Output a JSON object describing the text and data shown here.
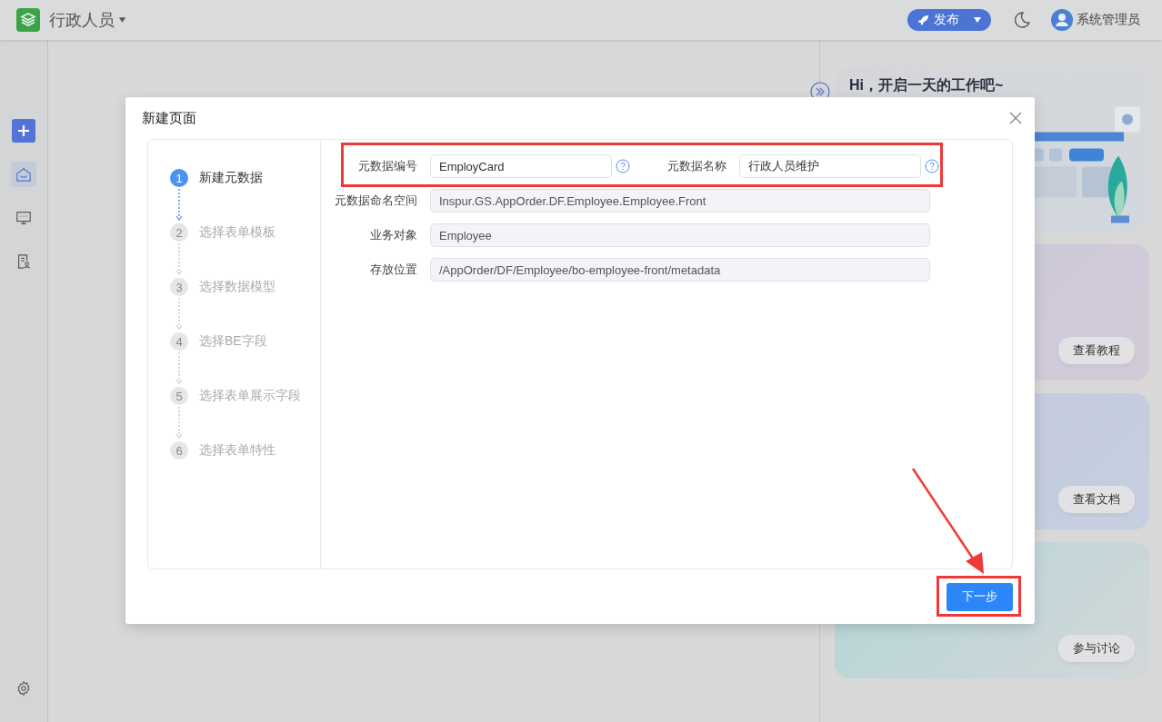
{
  "app": {
    "title": "行政人员",
    "publish_button": "发布",
    "user_name": "系统管理员"
  },
  "sidebar": {
    "items": [
      {
        "kind": "add",
        "selected": false
      },
      {
        "kind": "home",
        "selected": true
      },
      {
        "kind": "monitor",
        "selected": false
      },
      {
        "kind": "document",
        "selected": false
      }
    ]
  },
  "right_panel": {
    "greeting": "Hi，开启一天的工作吧~",
    "cards": [
      {
        "kind": "tutorial",
        "button": "查看教程"
      },
      {
        "kind": "docs",
        "button": "查看文档"
      },
      {
        "kind": "discuss",
        "button": "参与讨论"
      }
    ]
  },
  "dialog": {
    "title": "新建页面",
    "steps": [
      {
        "number": "1",
        "label": "新建元数据",
        "selected": true
      },
      {
        "number": "2",
        "label": "选择表单模板",
        "selected": false
      },
      {
        "number": "3",
        "label": "选择数据模型",
        "selected": false
      },
      {
        "number": "4",
        "label": "选择BE字段",
        "selected": false
      },
      {
        "number": "5",
        "label": "选择表单展示字段",
        "selected": false
      },
      {
        "number": "6",
        "label": "选择表单特性",
        "selected": false
      }
    ],
    "form_rows": [
      {
        "fields": [
          {
            "label": "元数据编号",
            "value": "EmployCard",
            "readonly": false,
            "help": true
          },
          {
            "label": "元数据名称",
            "value": "行政人员维护",
            "readonly": false,
            "help": true
          }
        ]
      },
      {
        "fields": [
          {
            "label": "元数据命名空间",
            "value": "Inspur.GS.AppOrder.DF.Employee.Employee.Front",
            "readonly": true
          }
        ]
      },
      {
        "fields": [
          {
            "label": "业务对象",
            "value": "Employee",
            "readonly": true
          }
        ]
      },
      {
        "fields": [
          {
            "label": "存放位置",
            "value": "/AppOrder/DF/Employee/bo-employee-front/metadata",
            "readonly": true
          }
        ]
      }
    ],
    "next_button": "下一步"
  }
}
